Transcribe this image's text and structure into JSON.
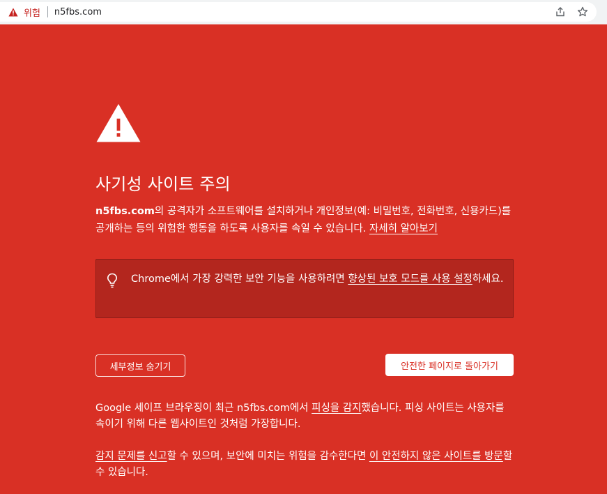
{
  "omnibox": {
    "label": "위험",
    "url": "n5fbs.com",
    "icons": [
      "warning-icon",
      "share-icon",
      "bookmark-star-icon"
    ]
  },
  "page": {
    "title": "사기성 사이트 주의",
    "desc": {
      "site": "n5fbs.com",
      "text": "의 공격자가 소프트웨어를 설치하거나 개인정보(예: 비밀번호, 전화번호, 신용카드)를 공개하는 등의 위험한 행동을 하도록 사용자를 속일 수 있습니다. ",
      "learn_more": "자세히 알아보기"
    },
    "enhanced": {
      "before": "Chrome에서 가장 강력한 보안 기능을 사용하려면 ",
      "link": "향상된 보호 모드를 사용 설정",
      "after": "하세요."
    },
    "buttons": {
      "details": "세부정보 숨기기",
      "back": "안전한 페이지로 돌아가기"
    },
    "details": {
      "p1_before": "Google 세이프 브라우징이 최근 n5fbs.com에서 ",
      "p1_link": "피싱을 감지",
      "p1_after": "했습니다. 피싱 사이트는 사용자를 속이기 위해 다른 웹사이트인 것처럼 가장합니다.",
      "p2_link1": "감지 문제를 신고",
      "p2_middle": "할 수 있으며, 보안에 미치는 위험을 감수한다면 ",
      "p2_link2": "이 안전하지 않은 사이트를 방문",
      "p2_after": "할 수 있습니다."
    }
  },
  "colors": {
    "background": "#d93025",
    "panel": "#b3261e",
    "omnibox_warning": "#c5221f"
  }
}
